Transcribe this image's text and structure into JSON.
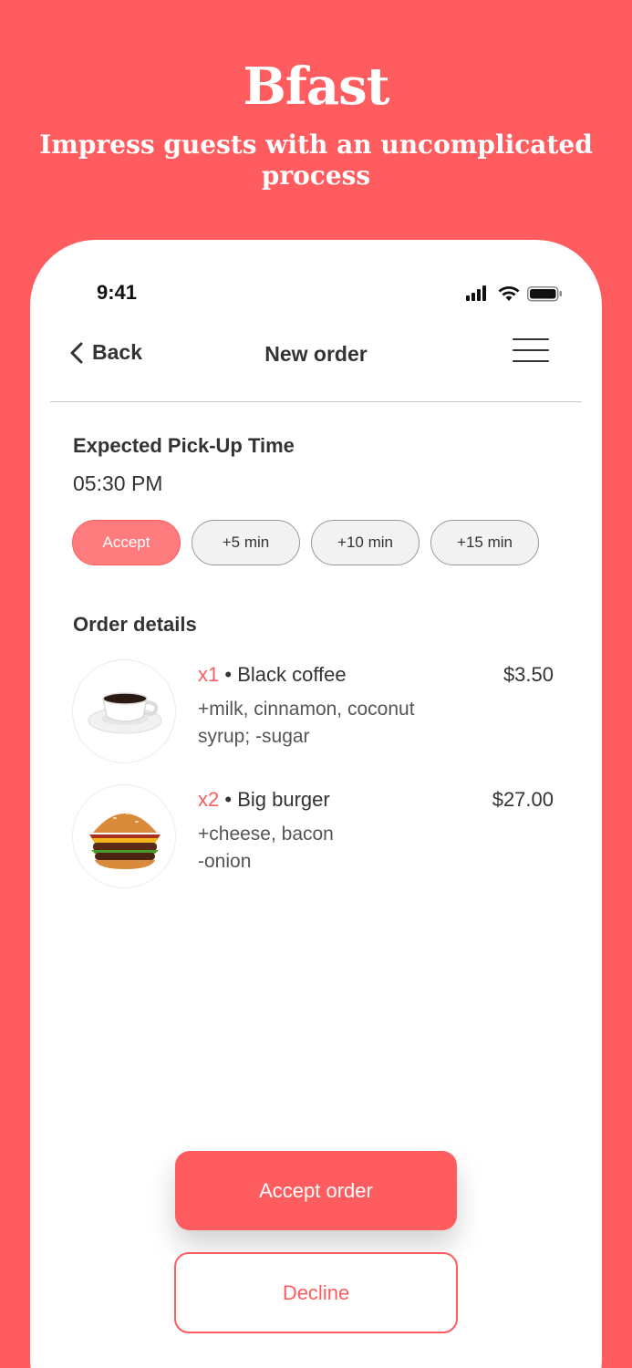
{
  "hero": {
    "title": "Bfast",
    "subtitle": "Impress guests with an uncomplicated process"
  },
  "status_bar": {
    "time": "9:41",
    "icons": [
      "signal-icon",
      "wifi-icon",
      "battery-icon"
    ]
  },
  "nav": {
    "back_label": "Back",
    "title": "New order",
    "menu_icon": "hamburger-menu-icon"
  },
  "pickup": {
    "label": "Expected Pick-Up Time",
    "time": "05:30 PM",
    "options": [
      "Accept",
      "+5 min",
      "+10 min",
      "+15 min"
    ],
    "selected": "Accept"
  },
  "order": {
    "label": "Order details",
    "items": [
      {
        "qty": "x1",
        "name": "• Black coffee",
        "price": "$3.50",
        "mods_line1": "+milk, cinnamon, coconut",
        "mods_line2": "syrup; -sugar",
        "image": "coffee-cup-image"
      },
      {
        "qty": "x2",
        "name": "• Big burger",
        "price": "$27.00",
        "mods_line1": "+cheese, bacon",
        "mods_line2": "-onion",
        "image": "burger-image"
      }
    ]
  },
  "actions": {
    "accept_label": "Accept order",
    "decline_label": "Decline"
  },
  "colors": {
    "accent": "#ff5c5f",
    "chip_active": "#ff7b7d",
    "text": "#333333"
  }
}
